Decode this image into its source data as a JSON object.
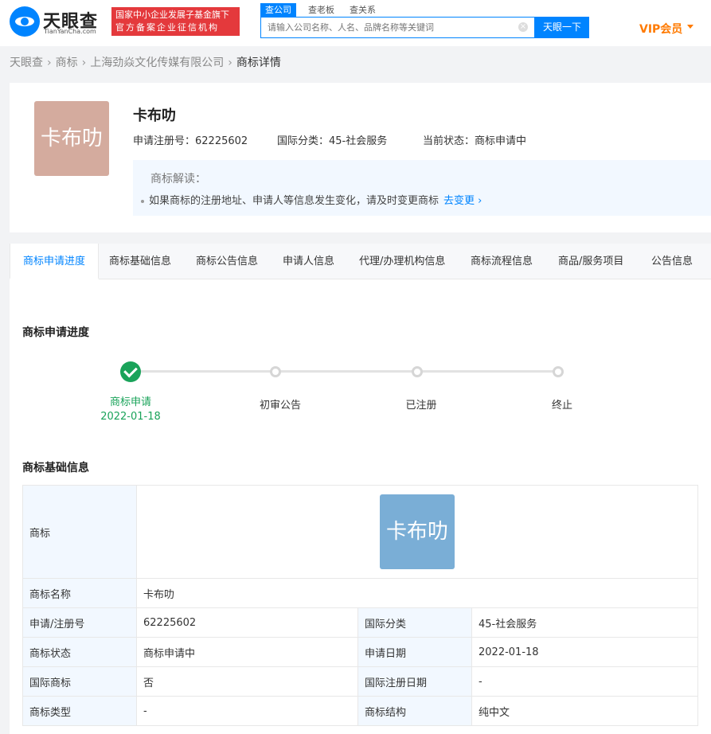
{
  "header": {
    "logo_cn": "天眼查",
    "logo_en": "TianYanCha.com",
    "gov_badge_line1": "国家中小企业发展子基金旗下",
    "gov_badge_line2": "官方备案企业征信机构",
    "search_tabs": [
      "查公司",
      "查老板",
      "查关系"
    ],
    "search_placeholder": "请输入公司名称、人名、品牌名称等关键词",
    "search_button": "天眼一下",
    "vip_label": "VIP会员"
  },
  "breadcrumb": [
    "天眼查",
    "商标",
    "上海劲焱文化传媒有限公司",
    "商标详情"
  ],
  "trademark": {
    "logo_text": "卡布叻",
    "name": "卡布叻",
    "reg_no_label": "申请注册号：",
    "reg_no": "62225602",
    "intl_class_label": "国际分类：",
    "intl_class": "45-社会服务",
    "status_label": "当前状态：",
    "status": "商标申请中",
    "tip_title": "商标解读：",
    "tip_text": "如果商标的注册地址、申请人等信息发生变化，请及时变更商标",
    "tip_link": "去变更"
  },
  "tabs": [
    "商标申请进度",
    "商标基础信息",
    "商标公告信息",
    "申请人信息",
    "代理/办理机构信息",
    "商标流程信息",
    "商品/服务项目",
    "公告信息"
  ],
  "progress": {
    "title": "商标申请进度",
    "steps": [
      {
        "label": "商标申请",
        "date": "2022-01-18"
      },
      {
        "label": "初审公告"
      },
      {
        "label": "已注册"
      },
      {
        "label": "终止"
      }
    ]
  },
  "basic_info": {
    "title": "商标基础信息",
    "logo_label": "商标",
    "logo_text": "卡布叻",
    "rows": [
      {
        "l1": "商标名称",
        "v1": "卡布叻"
      },
      {
        "l1": "申请/注册号",
        "v1": "62225602",
        "l2": "国际分类",
        "v2": "45-社会服务"
      },
      {
        "l1": "商标状态",
        "v1": "商标申请中",
        "l2": "申请日期",
        "v2": "2022-01-18"
      },
      {
        "l1": "国际商标",
        "v1": "否",
        "l2": "国际注册日期",
        "v2": "-"
      },
      {
        "l1": "商标类型",
        "v1": "-",
        "l2": "商标结构",
        "v2": "纯中文"
      }
    ]
  },
  "colors": {
    "brand": "#0084ff",
    "success": "#1aa35a",
    "vip": "#ff7a00",
    "gov_red": "#e4393c"
  }
}
